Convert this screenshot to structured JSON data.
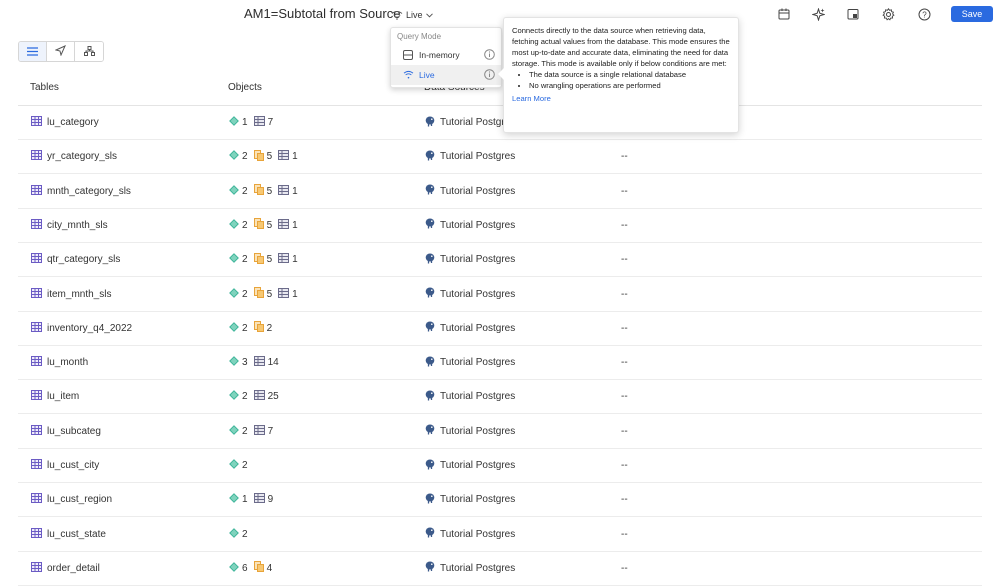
{
  "header": {
    "title": "AM1=Subtotal from Source",
    "mode_label": "Live",
    "save_label": "Save",
    "icons": [
      "calendar-icon",
      "sparkle-icon",
      "calendar-check-icon",
      "gear-icon",
      "help-icon"
    ]
  },
  "columns": {
    "tables": "Tables",
    "objects": "Objects",
    "data_sources": "Data Sources"
  },
  "rows": [
    {
      "name": "lu_category",
      "attr": "1",
      "metric": null,
      "cols": "7",
      "source": "Tutorial Postgres",
      "last": ""
    },
    {
      "name": "yr_category_sls",
      "attr": "2",
      "metric": "5",
      "cols": "1",
      "source": "Tutorial Postgres",
      "last": "--"
    },
    {
      "name": "mnth_category_sls",
      "attr": "2",
      "metric": "5",
      "cols": "1",
      "source": "Tutorial Postgres",
      "last": "--"
    },
    {
      "name": "city_mnth_sls",
      "attr": "2",
      "metric": "5",
      "cols": "1",
      "source": "Tutorial Postgres",
      "last": "--"
    },
    {
      "name": "qtr_category_sls",
      "attr": "2",
      "metric": "5",
      "cols": "1",
      "source": "Tutorial Postgres",
      "last": "--"
    },
    {
      "name": "item_mnth_sls",
      "attr": "2",
      "metric": "5",
      "cols": "1",
      "source": "Tutorial Postgres",
      "last": "--"
    },
    {
      "name": "inventory_q4_2022",
      "attr": "2",
      "metric": "2",
      "cols": null,
      "source": "Tutorial Postgres",
      "last": "--"
    },
    {
      "name": "lu_month",
      "attr": "3",
      "metric": null,
      "cols": "14",
      "source": "Tutorial Postgres",
      "last": "--"
    },
    {
      "name": "lu_item",
      "attr": "2",
      "metric": null,
      "cols": "25",
      "source": "Tutorial Postgres",
      "last": "--"
    },
    {
      "name": "lu_subcateg",
      "attr": "2",
      "metric": null,
      "cols": "7",
      "source": "Tutorial Postgres",
      "last": "--"
    },
    {
      "name": "lu_cust_city",
      "attr": "2",
      "metric": null,
      "cols": null,
      "source": "Tutorial Postgres",
      "last": "--"
    },
    {
      "name": "lu_cust_region",
      "attr": "1",
      "metric": null,
      "cols": "9",
      "source": "Tutorial Postgres",
      "last": "--"
    },
    {
      "name": "lu_cust_state",
      "attr": "2",
      "metric": null,
      "cols": null,
      "source": "Tutorial Postgres",
      "last": "--"
    },
    {
      "name": "order_detail",
      "attr": "6",
      "metric": "4",
      "cols": null,
      "source": "Tutorial Postgres",
      "last": "--"
    }
  ],
  "query_mode": {
    "label": "Query Mode",
    "options": [
      {
        "label": "In-memory",
        "selected": false
      },
      {
        "label": "Live",
        "selected": true
      }
    ]
  },
  "tooltip": {
    "text": "Connects directly to the data source when retrieving data, fetching actual values from the database. This mode ensures the most up-to-date and accurate data, eliminating the need for data storage. This mode is available only if below conditions are met:",
    "conditions": [
      "The data source is a single relational database",
      "No wrangling operations are performed"
    ],
    "link": "Learn More"
  },
  "colors": {
    "accent": "#2a6ae0",
    "table_icon": "#6b5bc4",
    "attribute_icon": "#3fb59a",
    "metric_icon": "#e8a43a",
    "source_icon": "#3c5a8a"
  }
}
